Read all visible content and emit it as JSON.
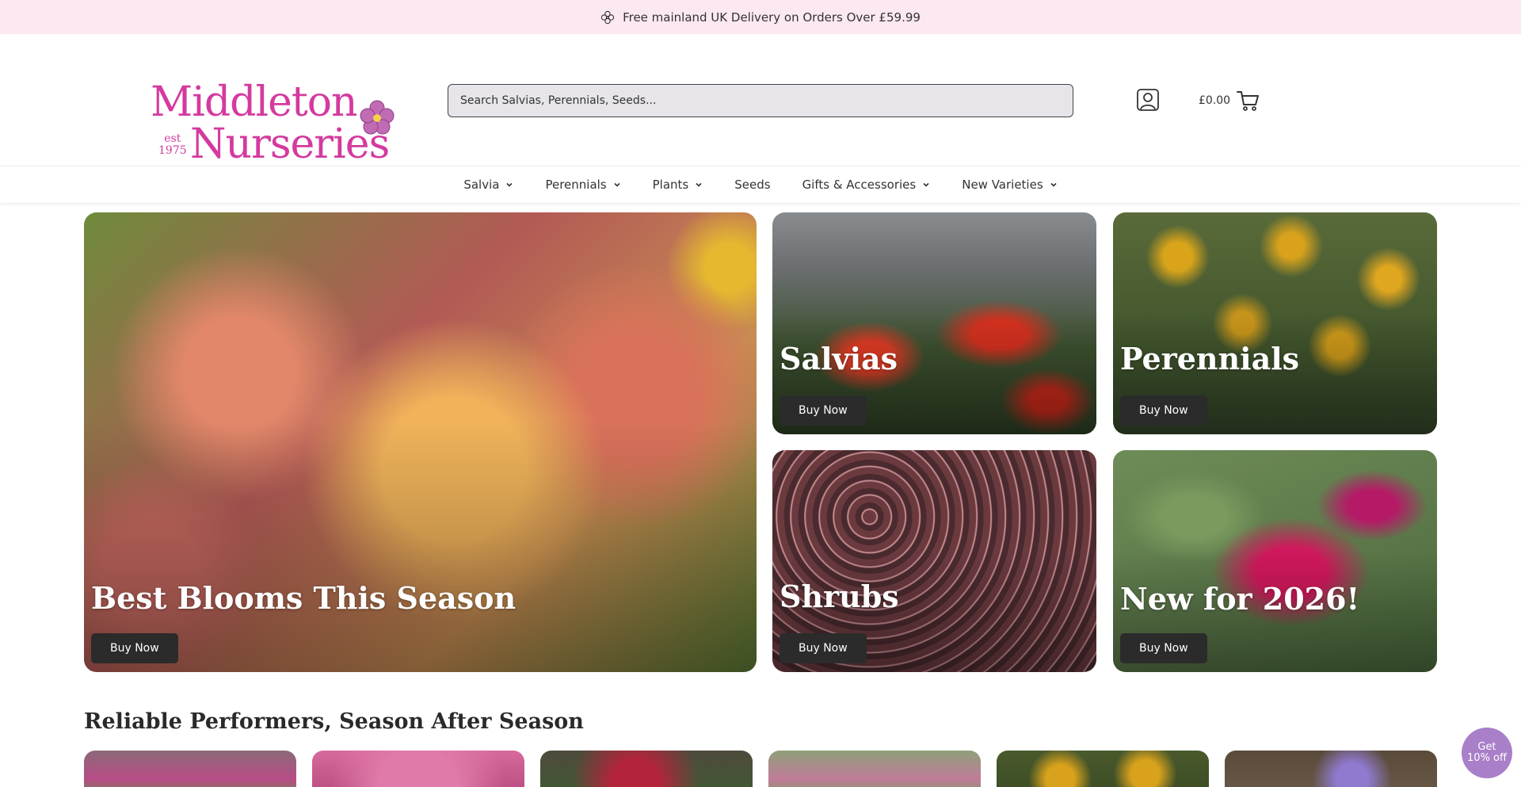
{
  "announcement": {
    "text": "Free mainland UK Delivery on Orders Over £59.99",
    "icon": "flower-icon"
  },
  "header": {
    "logo": {
      "line1": "Middleton",
      "line2": "Nurseries",
      "est_line1": "est",
      "est_line2": "1975"
    },
    "search": {
      "placeholder": "Search Salvias, Perennials, Seeds..."
    },
    "account_icon": "user-icon",
    "cart": {
      "total": "£0.00",
      "icon": "cart-icon"
    }
  },
  "nav": {
    "items": [
      {
        "label": "Salvia",
        "dropdown": true
      },
      {
        "label": "Perennials",
        "dropdown": true
      },
      {
        "label": "Plants",
        "dropdown": true
      },
      {
        "label": "Seeds",
        "dropdown": false
      },
      {
        "label": "Gifts & Accessories",
        "dropdown": true
      },
      {
        "label": "New Varieties",
        "dropdown": true
      }
    ]
  },
  "hero": {
    "main": {
      "title": "Best Blooms This Season",
      "button": "Buy Now"
    },
    "salvias": {
      "title": "Salvias",
      "button": "Buy Now"
    },
    "perennials": {
      "title": "Perennials",
      "button": "Buy Now"
    },
    "shrubs": {
      "title": "Shrubs",
      "button": "Buy Now"
    },
    "new": {
      "title": "New for 2026!",
      "button": "Buy Now"
    }
  },
  "section": {
    "title": "Reliable Performers, Season After Season"
  },
  "promo": {
    "line1": "Get",
    "line2": "10% off"
  },
  "colors": {
    "brand_pink": "#d43a9f",
    "announcement_bg": "#fce8f3",
    "button_dark": "#2b2b2b",
    "promo_purple": "#a97fc9"
  }
}
